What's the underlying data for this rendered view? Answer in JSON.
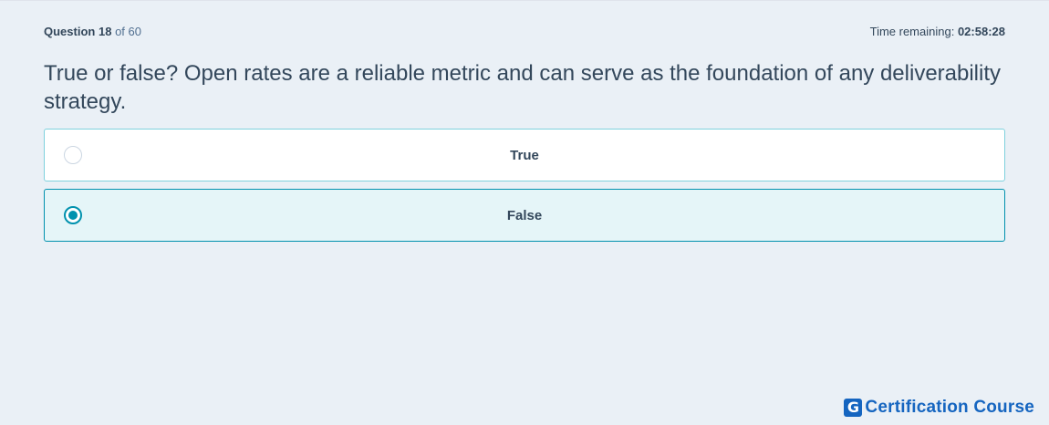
{
  "header": {
    "question_word": "Question",
    "question_number": "18",
    "question_of": "of 60",
    "time_label": "Time remaining:",
    "time_value": "02:58:28"
  },
  "question": {
    "text": "True or false? Open rates are a reliable metric and can serve as the foundation of any deliverability strategy."
  },
  "options": [
    {
      "label": "True",
      "selected": false
    },
    {
      "label": "False",
      "selected": true
    }
  ],
  "brand": {
    "icon_letter": "G",
    "text": "Certification Course",
    "color": "#1565c0"
  },
  "colors": {
    "background": "#eaf0f6",
    "accent": "#0091ae",
    "selected_bg": "#e5f5f8",
    "text": "#33475b"
  }
}
